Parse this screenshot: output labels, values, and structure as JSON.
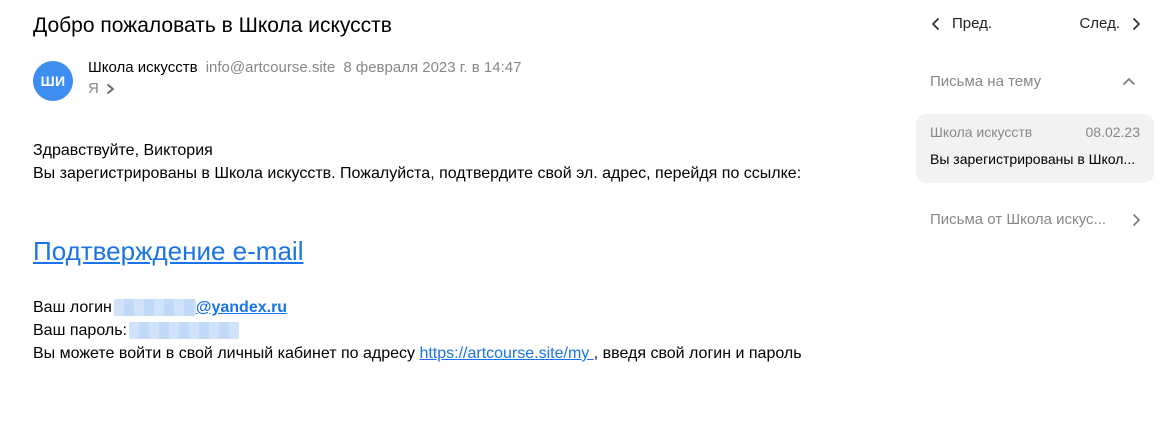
{
  "message": {
    "subject": "Добро пожаловать в Школа искусств",
    "avatar_initials": "ШИ",
    "avatar_color": "#3d8ef0",
    "sender_name": "Школа искусств",
    "sender_email": "info@artcourse.site",
    "date": "8 февраля 2023 г. в 14:47",
    "recipient": "Я"
  },
  "body": {
    "greeting": "Здравствуйте, Виктория",
    "intro": "Вы зарегистрированы в Школа искусств. Пожалуйста, подтвердите свой эл. адрес, перейдя по ссылке:",
    "confirm_link": "Подтверждение e-mail",
    "login_label": "Ваш логин",
    "login_domain": "@yandex.ru",
    "password_label": "Ваш пароль:",
    "cabinet_text_before": "Вы можете войти в свой личный кабинет по адресу ",
    "cabinet_link": "https://artcourse.site/my ",
    "cabinet_text_after": ", введя свой логин и пароль",
    "link_color": "#1a73e8"
  },
  "sidebar": {
    "prev_label": "Пред.",
    "next_label": "След.",
    "thread_label": "Письма на тему",
    "thread_card": {
      "sender": "Школа искусств",
      "date": "08.02.23",
      "snippet": "Вы зарегистрированы в Школ..."
    },
    "from_sender_label": "Письма от Школа искус..."
  }
}
